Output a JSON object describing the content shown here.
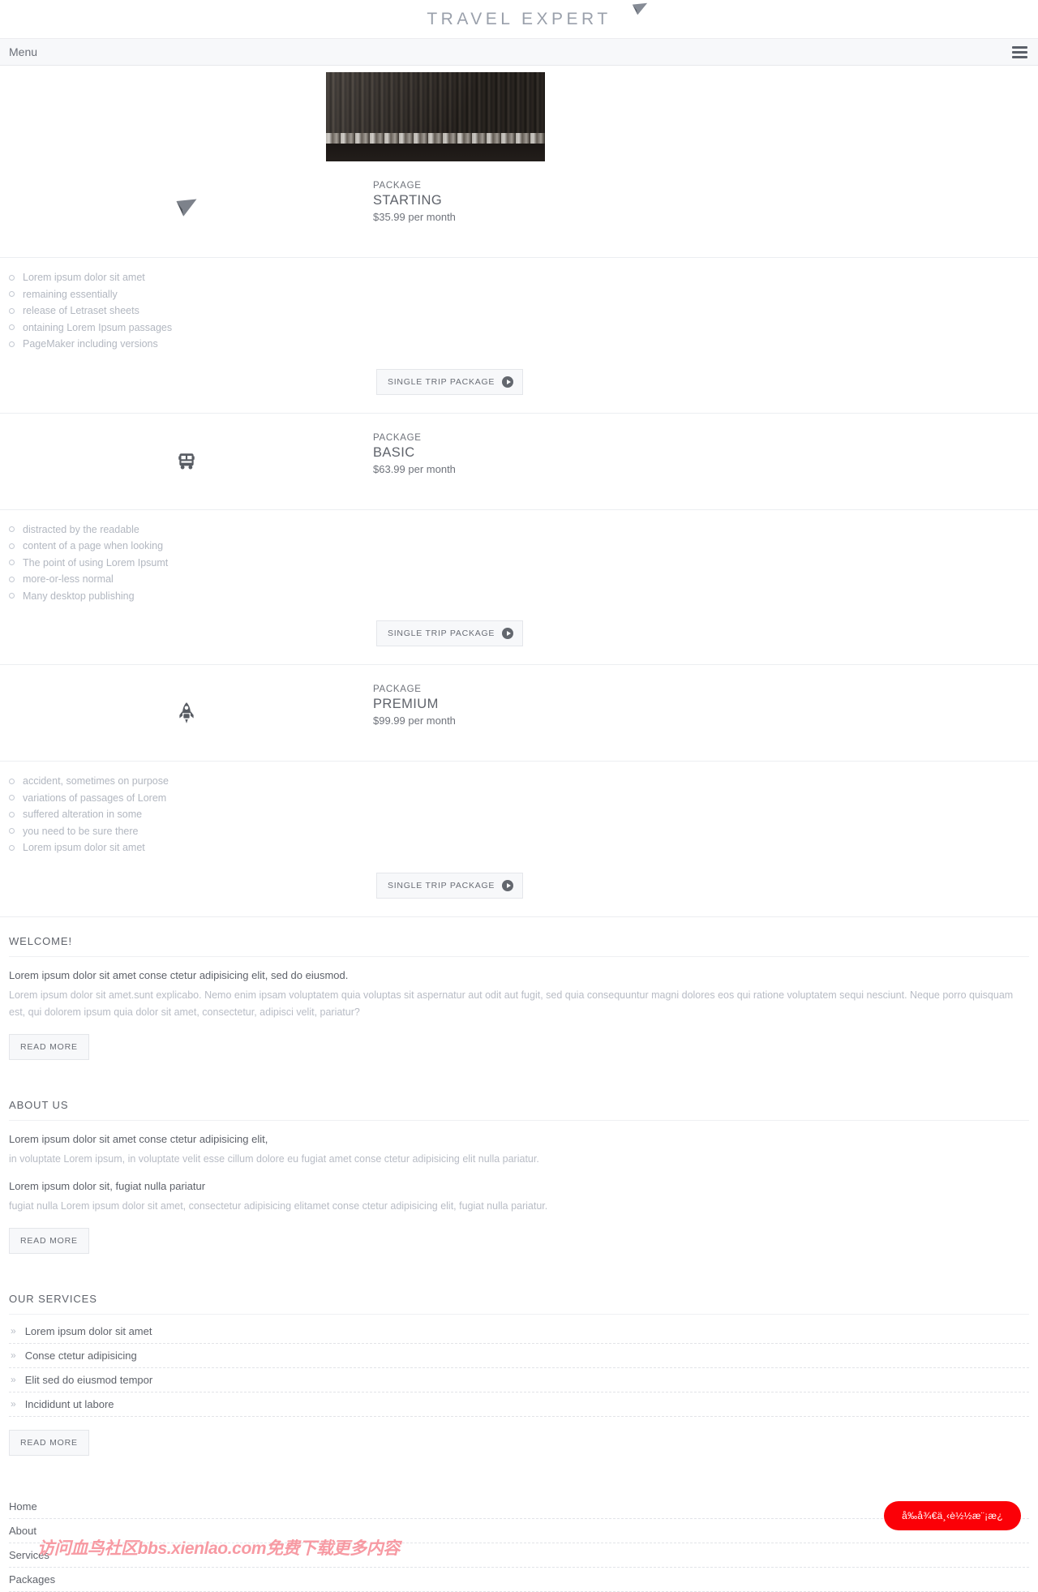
{
  "brand": {
    "logo_text": "TRAVEL EXPERT",
    "plane_icon": "paper-plane-icon"
  },
  "menubar": {
    "label": "Menu",
    "hamburger_icon": "hamburger-menu-icon"
  },
  "packages": [
    {
      "icon": "paper-plane-icon",
      "kicker": "PACKAGE",
      "name": "STARTING",
      "price": "$35.99 per month",
      "features": [
        "Lorem ipsum dolor sit amet",
        "remaining essentially",
        "release of Letraset sheets",
        "ontaining Lorem Ipsum passages",
        "PageMaker including versions"
      ],
      "cta": "SINGLE TRIP PACKAGE"
    },
    {
      "icon": "bus-icon",
      "kicker": "PACKAGE",
      "name": "BASIC",
      "price": "$63.99 per month",
      "features": [
        "distracted by the readable",
        "content of a page when looking",
        "The point of using Lorem Ipsumt",
        "more-or-less normal",
        "Many desktop publishing"
      ],
      "cta": "SINGLE TRIP PACKAGE"
    },
    {
      "icon": "rocket-icon",
      "kicker": "PACKAGE",
      "name": "PREMIUM",
      "price": "$99.99 per month",
      "features": [
        "accident, sometimes on purpose",
        "variations of passages of Lorem",
        "suffered alteration in some",
        "you need to be sure there",
        "Lorem ipsum dolor sit amet"
      ],
      "cta": "SINGLE TRIP PACKAGE"
    }
  ],
  "welcome": {
    "title": "WELCOME!",
    "lead": "Lorem ipsum dolor sit amet conse ctetur adipisicing elit, sed do eiusmod.",
    "body": "Lorem ipsum dolor sit amet.sunt explicabo. Nemo enim ipsam voluptatem quia voluptas sit aspernatur aut odit aut fugit, sed quia consequuntur magni dolores eos qui ratione voluptatem sequi nesciunt. Neque porro quisquam est, qui dolorem ipsum quia dolor sit amet, consectetur, adipisci velit, pariatur?",
    "button": "READ MORE"
  },
  "about": {
    "title": "ABOUT US",
    "lead1": "Lorem ipsum dolor sit amet conse ctetur adipisicing elit,",
    "body1": "in voluptate Lorem ipsum, in voluptate velit esse cillum dolore eu fugiat amet conse ctetur adipisicing elit nulla pariatur.",
    "lead2": "Lorem ipsum dolor sit, fugiat nulla pariatur",
    "body2": "fugiat nulla Lorem ipsum dolor sit amet, consectetur adipisicing elitamet conse ctetur adipisicing elit, fugiat nulla pariatur.",
    "button": "READ MORE"
  },
  "services": {
    "title": "OUR SERVICES",
    "items": [
      "Lorem ipsum dolor sit amet",
      "Conse ctetur adipisicing",
      "Elit sed do eiusmod tempor",
      "Incididunt ut labore"
    ],
    "button": "READ MORE",
    "chevron_icon": "double-chevron-right-icon"
  },
  "footer": {
    "links": [
      "Home",
      "About",
      "Services",
      "Packages"
    ]
  },
  "floating_badge": {
    "text": "å‰å¾€ä¸‹è½½æ¨¡æ¿"
  },
  "watermark": {
    "text": "访问血鸟社区bbs.xienlao.com免费下载更多内容"
  },
  "colors": {
    "badge_red": "#fb0007",
    "text_primary": "#5f636b",
    "text_muted": "#b8bcc5",
    "bar_bg": "#f7f8fa"
  }
}
